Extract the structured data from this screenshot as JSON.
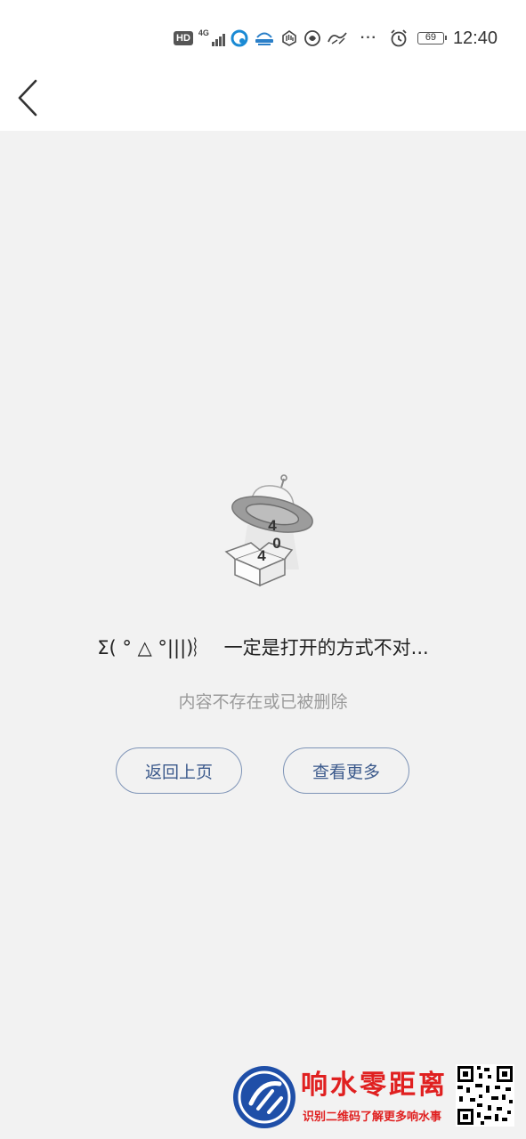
{
  "status_bar": {
    "hd_badge": "HD",
    "network_type": "4G",
    "overflow_indicator": "···",
    "battery_level": "69",
    "time": "12:40"
  },
  "nav": {
    "back_icon": "chevron-left-icon"
  },
  "error": {
    "illustration_digits": [
      "4",
      "0",
      "4"
    ],
    "title": "Σ( ° △ °|||)︴  一定是打开的方式不对...",
    "subtitle": "内容不存在或已被删除",
    "back_button_label": "返回上页",
    "more_button_label": "查看更多"
  },
  "watermark": {
    "title": "响水零距离",
    "subtitle": "识别二维码了解更多响水事"
  },
  "colors": {
    "page_background": "#f2f2f2",
    "button_border": "#7d93b6",
    "button_text": "#3c5a8c",
    "subtitle_text": "#9a9a9a",
    "watermark_red": "#e02020",
    "watermark_blue": "#1f4fa8"
  }
}
